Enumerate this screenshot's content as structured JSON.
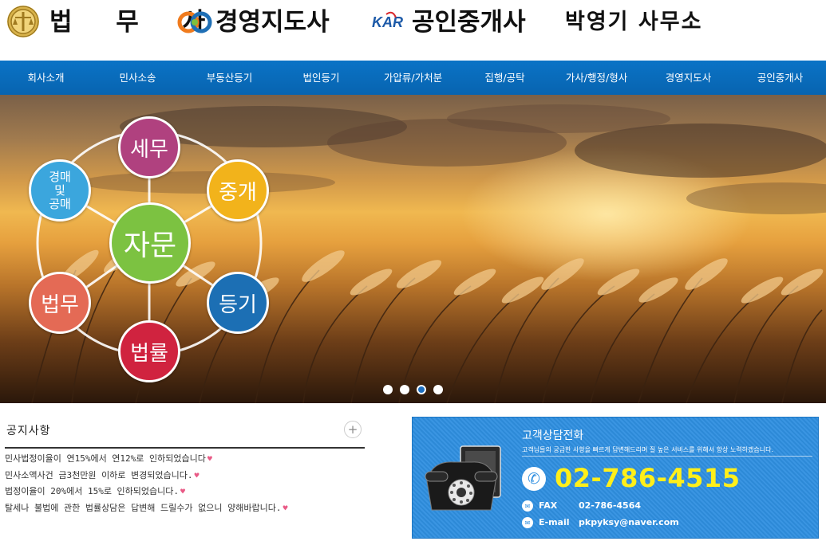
{
  "header": {
    "brand1": "법 무 사",
    "brand2": "경영지도사",
    "brand3": "공인중개사",
    "brand4": "박영기 사무소",
    "kar_logo_text": "KAR"
  },
  "nav": {
    "items": [
      "회사소개",
      "민사소송",
      "부동산등기",
      "법인등기",
      "가압류/가처분",
      "집행/공탁",
      "가사/행정/형사",
      "경영지도사",
      "공인중개사"
    ]
  },
  "hero": {
    "center": "자문",
    "top": "세무",
    "top_right": "중개",
    "bottom_right": "등기",
    "bottom": "법률",
    "bottom_left": "법무",
    "top_left_lines": [
      "경매",
      "및",
      "공매"
    ],
    "slide_count": 4,
    "active_slide": 3,
    "colors": {
      "center": "#7cc241",
      "top": "#b0417f",
      "top_right": "#f2b31b",
      "bottom_right": "#1c6fb4",
      "bottom": "#d0233f",
      "bottom_left": "#e46a55",
      "top_left": "#3ba6dd"
    }
  },
  "notice": {
    "title": "공지사항",
    "more": "+",
    "items": [
      "민사법정이율이 연15%에서 연12%로 인하되었습니다",
      "민사소액사건 금3천만원 이하로 변경되었습니다.",
      "법정이율이 20%에서 15%로 인하되었습니다.",
      "탈세나 불법에 관한 법률상담은 답변해 드릴수가 없으니 양해바랍니다."
    ]
  },
  "contact": {
    "title": "고객상담전화",
    "desc": "고객님들의 궁금한 사항을 빠르게 답변해드리며 질 높은 서비스를 위해서 항상 노력하겠습니다.",
    "phone": "02-786-4515",
    "fax_label": "FAX",
    "fax_value": "02-786-4564",
    "email_label": "E-mail",
    "email_value": "pkpyksy@naver.com"
  },
  "colors": {
    "nav": "#0a73c6",
    "phone_number": "#ffef1a",
    "contact_bg": "#2f8fe0"
  }
}
